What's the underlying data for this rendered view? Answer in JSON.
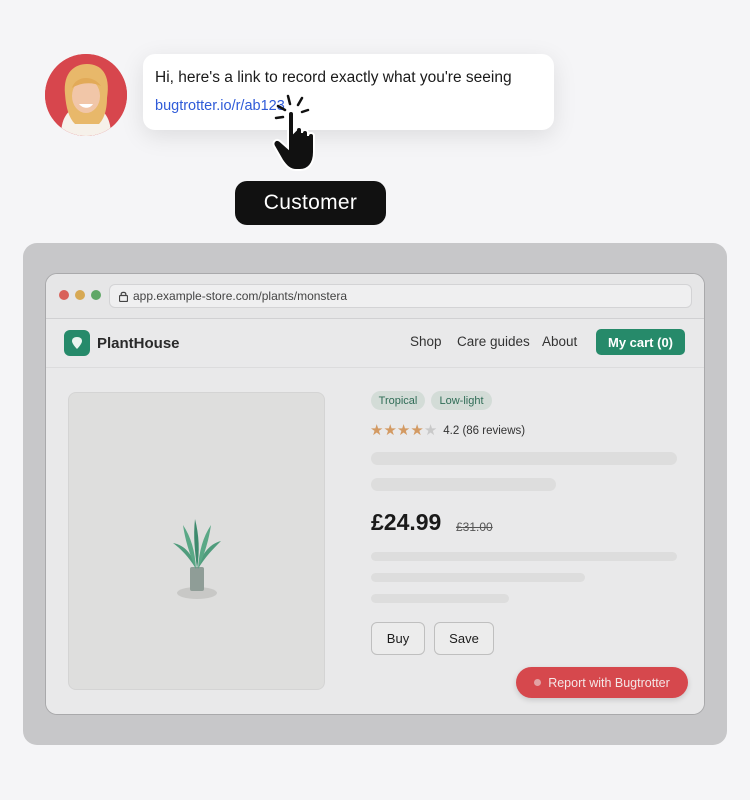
{
  "chat": {
    "message": "Hi, here's a link to record exactly what you're seeing",
    "link": "bugtrotter.io/r/ab123",
    "sender_tag": "Customer"
  },
  "browser": {
    "url": "app.example-store.com/plants/monstera"
  },
  "site": {
    "brand": "PlantHouse",
    "nav": [
      "Shop",
      "Care guides",
      "About"
    ],
    "cart_label": "My cart (0)"
  },
  "product": {
    "tags": [
      "Tropical",
      "Low-light"
    ],
    "rating_text": "4.2 (86 reviews)",
    "rating_value": 4.2,
    "rating_max": 5,
    "price": "£24.99",
    "old_price": "£31.00",
    "buy_label": "Buy",
    "save_label": "Save"
  },
  "report_button": "Report with Bugtrotter",
  "colors": {
    "accent": "#268a6a",
    "report": "#d6484d",
    "link": "#2f5bd8"
  }
}
